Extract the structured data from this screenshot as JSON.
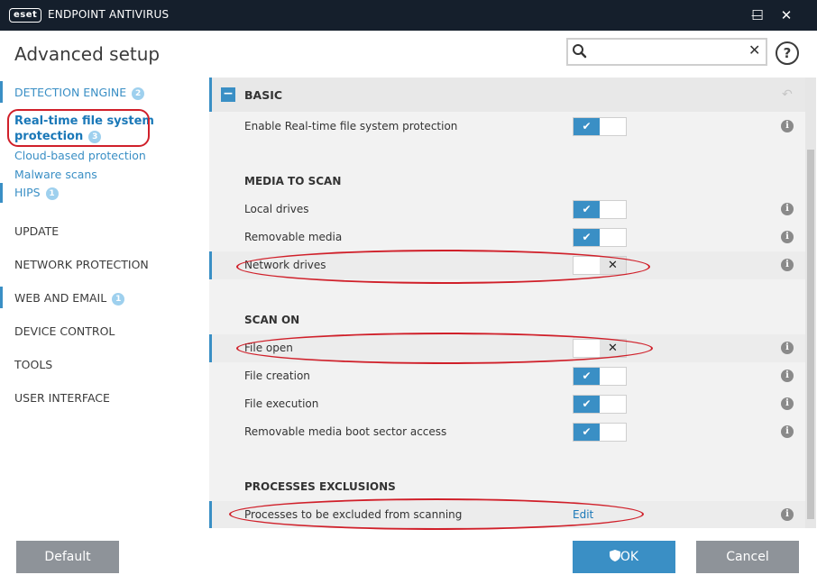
{
  "window": {
    "logo_text": "eset",
    "title": "ENDPOINT ANTIVIRUS",
    "minimize": "—",
    "maximize": "☐",
    "close": "✕"
  },
  "header": {
    "title": "Advanced setup",
    "search_placeholder": "",
    "search_clear": "✕",
    "help": "?"
  },
  "sidebar": {
    "items": [
      {
        "label": "DETECTION ENGINE",
        "badge": "2"
      },
      {
        "label_line1": "Real-time file system",
        "label_line2": "protection",
        "badge": "3"
      },
      {
        "label": "Cloud-based protection"
      },
      {
        "label": "Malware scans"
      },
      {
        "label": "HIPS",
        "badge": "1"
      },
      {
        "label": "UPDATE"
      },
      {
        "label": "NETWORK PROTECTION"
      },
      {
        "label": "WEB AND EMAIL",
        "badge": "1"
      },
      {
        "label": "DEVICE CONTROL"
      },
      {
        "label": "TOOLS"
      },
      {
        "label": "USER INTERFACE"
      }
    ]
  },
  "panel": {
    "section_title": "BASIC",
    "collapse_glyph": "−",
    "revert_glyph": "↶",
    "info_glyph": "i",
    "rows": {
      "enable_rt": {
        "label": "Enable Real-time file system protection",
        "state": "on"
      },
      "media_header": "MEDIA TO SCAN",
      "local_drives": {
        "label": "Local drives",
        "state": "on"
      },
      "removable_media": {
        "label": "Removable media",
        "state": "on"
      },
      "network_drives": {
        "label": "Network drives",
        "state": "off"
      },
      "scan_on_header": "SCAN ON",
      "file_open": {
        "label": "File open",
        "state": "off"
      },
      "file_creation": {
        "label": "File creation",
        "state": "on"
      },
      "file_execution": {
        "label": "File execution",
        "state": "on"
      },
      "boot_sector": {
        "label": "Removable media boot sector access",
        "state": "on"
      },
      "exclusions_header": "PROCESSES EXCLUSIONS",
      "processes": {
        "label": "Processes to be excluded from scanning",
        "link": "Edit"
      }
    },
    "toggle_on_glyph": "✔",
    "toggle_off_glyph": "✕"
  },
  "footer": {
    "default_label": "Default",
    "ok_label": "OK",
    "cancel_label": "Cancel"
  },
  "colors": {
    "accent": "#3a8fc5",
    "titlebar": "#151f2c",
    "highlight": "#d0202a",
    "button_gray": "#8e9399"
  }
}
